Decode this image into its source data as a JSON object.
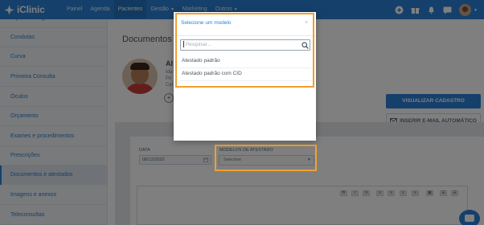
{
  "topbar": {
    "app_name": "iClinic",
    "nav": [
      {
        "label": "Painel",
        "active": false,
        "dropdown": false
      },
      {
        "label": "Agenda",
        "active": false,
        "dropdown": false
      },
      {
        "label": "Pacientes",
        "active": true,
        "dropdown": false
      },
      {
        "label": "Gestão",
        "active": false,
        "dropdown": true
      },
      {
        "label": "Marketing",
        "active": false,
        "dropdown": false
      },
      {
        "label": "Outros",
        "active": false,
        "dropdown": true
      }
    ],
    "icons": [
      "plus-circle-icon",
      "gift-icon",
      "bell-icon",
      "chat-icon",
      "user-avatar"
    ]
  },
  "sidebar": {
    "items": [
      {
        "label": "Hipótese diagnóstica",
        "active": false
      },
      {
        "label": "Condutas",
        "active": false
      },
      {
        "label": "Curva",
        "active": false
      },
      {
        "label": "Primeira Consulta",
        "active": false
      },
      {
        "label": "Óculos",
        "active": false
      },
      {
        "label": "Orçamento",
        "active": false
      },
      {
        "label": "Exames e procedimentos",
        "active": false
      },
      {
        "label": "Prescrições",
        "active": false
      },
      {
        "label": "Documentos e atestados",
        "active": true
      },
      {
        "label": "Imagens e anexos",
        "active": false
      },
      {
        "label": "Teleconsultas",
        "active": false
      }
    ]
  },
  "main": {
    "page_title": "Documentos e",
    "patient": {
      "name_partial": "Al",
      "line1": "Ida",
      "line2": "Pri",
      "line3": "Cel",
      "add_symbol": "+"
    },
    "view_button": "VISUALIZAR CADASTRO",
    "email_button": "INSERIR E-MAIL AUTOMÁTICO",
    "form": {
      "date_label": "DATA",
      "date_value": "08/12/2020",
      "models_label": "MODELOS DE ATESTADO",
      "models_value": "Selecione"
    },
    "editor_tools": [
      "B",
      "I",
      "U",
      "≡",
      "≡",
      "≡",
      "≡",
      "▦",
      "☰",
      "☰"
    ]
  },
  "modal": {
    "title": "Selecione um modelo",
    "close": "×",
    "search_placeholder": "Pesquisar...",
    "options": [
      "Atestado padrão",
      "Atestado padrão com CID"
    ]
  },
  "colors": {
    "brand": "#2a81d6",
    "highlight": "#f0a030",
    "overlay": "rgba(0,0,0,0.5)"
  }
}
